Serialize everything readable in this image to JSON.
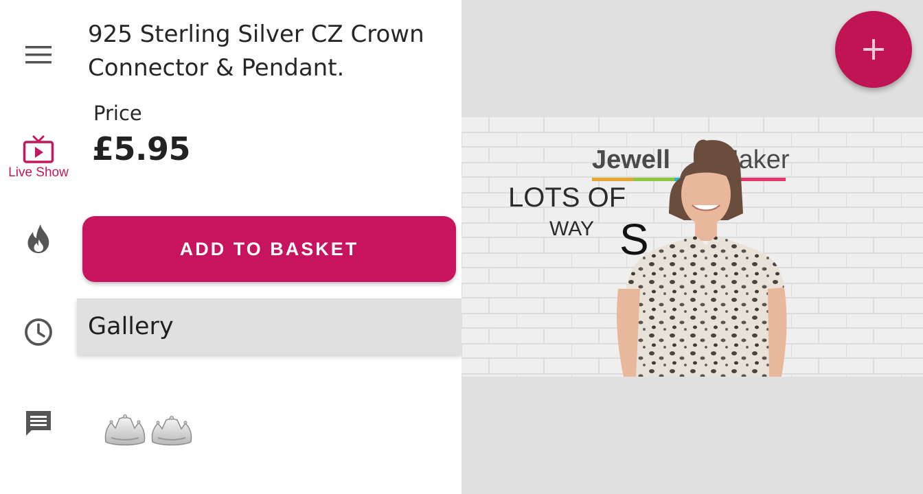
{
  "nav": {
    "items": [
      {
        "icon": "menu-icon"
      },
      {
        "icon": "live-tv-icon",
        "label": "Live Show",
        "active": true
      },
      {
        "icon": "hot-flame-icon"
      },
      {
        "icon": "clock-history-icon"
      },
      {
        "icon": "chat-message-icon"
      }
    ],
    "active_color": "#c2185b",
    "icon_color": "#555555"
  },
  "product": {
    "title": "925 Sterling Silver CZ Crown Connector & Pendant.",
    "price_label": "Price",
    "price": "£5.95"
  },
  "actions": {
    "add_to_basket": "ADD TO BASKET",
    "fab_icon": "plus-icon"
  },
  "gallery": {
    "title": "Gallery",
    "thumbnails": [
      {
        "icon": "crown-earrings-image"
      }
    ]
  },
  "video": {
    "brand_text_left": "Jewell",
    "brand_text_right": "Maker",
    "overlay_line1": "LOTS OF",
    "overlay_line2": "WAY",
    "overlay_letter": "S"
  },
  "colors": {
    "accent": "#c8145e",
    "panel_header_bg": "#e0e0e0",
    "background": "#e0e0e0"
  }
}
